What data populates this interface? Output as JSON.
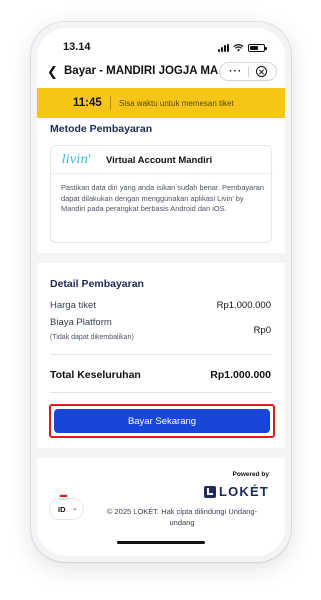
{
  "status_bar": {
    "time": "13.14"
  },
  "navbar": {
    "title": "Bayar - MANDIRI JOGJA MA...",
    "more_icon": "···"
  },
  "timer": {
    "time": "11:45",
    "text": "Sisa waktu untuk memesan tiket"
  },
  "payment_method": {
    "section_title": "Metode Pembayaran",
    "logo_text": "livin'",
    "name": "Virtual Account Mandiri",
    "description": "Pastikan data diri yang anda isikan sudah benar. Pembayaran dapat dilakukan dengan menggunakan aplikasi Livin' by Mandiri pada perangkat berbasis Android dan iOS."
  },
  "payment_detail": {
    "section_title": "Detail Pembayaran",
    "rows": [
      {
        "label": "Harga tiket",
        "value": "Rp1.000.000"
      },
      {
        "label": "Biaya Platform",
        "note": "(Tidak dapat dikembalikan)",
        "value": "Rp0"
      }
    ],
    "total_label": "Total Keseluruhan",
    "total_value": "Rp1.000.000"
  },
  "pay_button": {
    "label": "Bayar Sekarang"
  },
  "footer": {
    "powered_by": "Powered by",
    "brand": "LOKÉT",
    "language": "ID",
    "copyright": "© 2025 LOKÉT.  Hak cipta dilindungi Undang-undang"
  },
  "colors": {
    "timer_bg": "#f5c518",
    "primary_button": "#1746d8",
    "highlight_border": "#e3191f",
    "heading": "#1e2a5a"
  }
}
